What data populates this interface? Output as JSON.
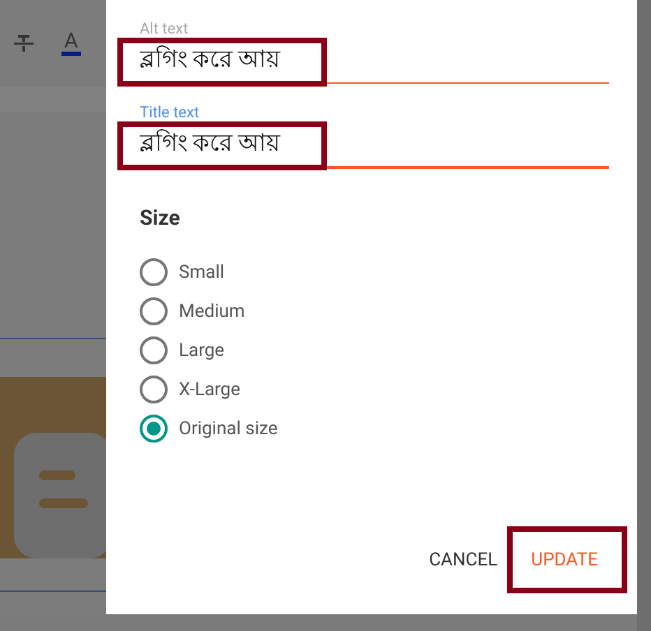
{
  "editor_background": {
    "toolbar": [
      {
        "kind": "strikethrough"
      },
      {
        "kind": "text_color",
        "glyph": "A"
      }
    ],
    "content": [
      {
        "kind": "rule"
      },
      {
        "kind": "picture"
      },
      {
        "kind": "rule"
      }
    ]
  },
  "dialog": {
    "fields": [
      {
        "label": "Alt text",
        "value": "ব্লগিং করে আয়",
        "focused": false,
        "highlighted": true
      },
      {
        "label": "Title text",
        "value": "ব্লগিং করে আয়",
        "focused": true,
        "highlighted": true
      }
    ],
    "size": {
      "heading": "Size",
      "options": [
        {
          "label": "Small",
          "selected": false
        },
        {
          "label": "Medium",
          "selected": false
        },
        {
          "label": "Large",
          "selected": false
        },
        {
          "label": "X-Large",
          "selected": false
        },
        {
          "label": "Original size",
          "selected": true
        }
      ]
    },
    "buttons": [
      {
        "label": "CANCEL",
        "kind": "plain"
      },
      {
        "label": "UPDATE",
        "kind": "primary",
        "highlighted": true
      }
    ]
  }
}
